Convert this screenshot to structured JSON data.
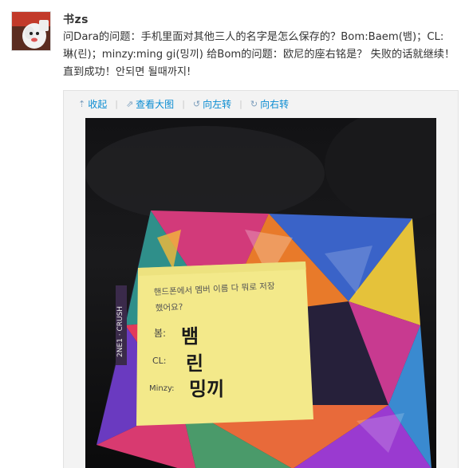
{
  "user": {
    "name": "书zs",
    "avatar_icon": "avatar-cartoon-icon"
  },
  "post": {
    "line1": "问Dara的问题：手机里面对其他三人的名字是怎么保存的？Bom:Baem(뱀)；CL:",
    "line2": "琳(린)；minzy:ming gi(밍끼) 给Bom的问题：欧尼的座右铭是？ 失败的话就继续！",
    "line3": "直到成功！안되면 될때까지!"
  },
  "toolbar": {
    "collapse": "收起",
    "view_large": "查看大图",
    "rotate_left": "向左转",
    "rotate_right": "向右转",
    "icons": {
      "collapse": "arrow-up-icon",
      "view_large": "external-link-icon",
      "rotate_left": "rotate-left-icon",
      "rotate_right": "rotate-right-icon"
    }
  },
  "photo": {
    "note_lines": {
      "l1": "핸드폰에서 멤버 이름 다 뭐로 저장",
      "l2": "했어요?",
      "bom_label": "봄:",
      "bom_value": "뱀",
      "cl_label": "CL:",
      "cl_value": "린",
      "minzy_label": "Minzy:",
      "minzy_value": "밍끼"
    },
    "spine_text": "2NE1 · CRUSH"
  },
  "colors": {
    "link": "#0a8cd2",
    "text": "#333333",
    "note": "#f4e98a",
    "photo_bg": "#0b0b0d"
  }
}
